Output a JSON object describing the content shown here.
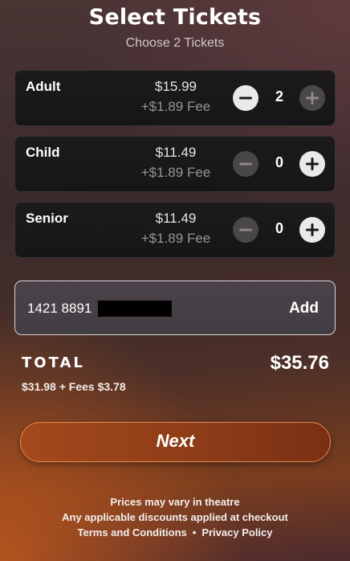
{
  "header": {
    "title": "Select Tickets",
    "subtitle": "Choose 2 Tickets"
  },
  "tickets": [
    {
      "name": "Adult",
      "price": "$15.99",
      "fee": "+$1.89 Fee",
      "quantity": "2",
      "minus_enabled": true,
      "plus_enabled": false
    },
    {
      "name": "Child",
      "price": "$11.49",
      "fee": "+$1.89 Fee",
      "quantity": "0",
      "minus_enabled": false,
      "plus_enabled": true
    },
    {
      "name": "Senior",
      "price": "$11.49",
      "fee": "+$1.89 Fee",
      "quantity": "0",
      "minus_enabled": false,
      "plus_enabled": true
    }
  ],
  "icons": {
    "minus": "minus-circle-icon",
    "plus": "plus-circle-icon"
  },
  "promo": {
    "code_visible": "1421 8891",
    "add_label": "Add"
  },
  "total": {
    "label": "TOTAL",
    "amount": "$35.76",
    "breakdown": "$31.98 + Fees $3.78"
  },
  "next_button": {
    "label": "Next"
  },
  "footer": {
    "line1": "Prices may vary in theatre",
    "line2": "Any applicable discounts applied at checkout",
    "terms": "Terms and Conditions",
    "separator": "•",
    "privacy": "Privacy Policy"
  },
  "colors": {
    "accent": "#9a4219",
    "accent_border": "#e48a52",
    "card_bg": "#1a181a",
    "button_active": "#e9e9ec",
    "button_inactive": "#4a4749"
  }
}
